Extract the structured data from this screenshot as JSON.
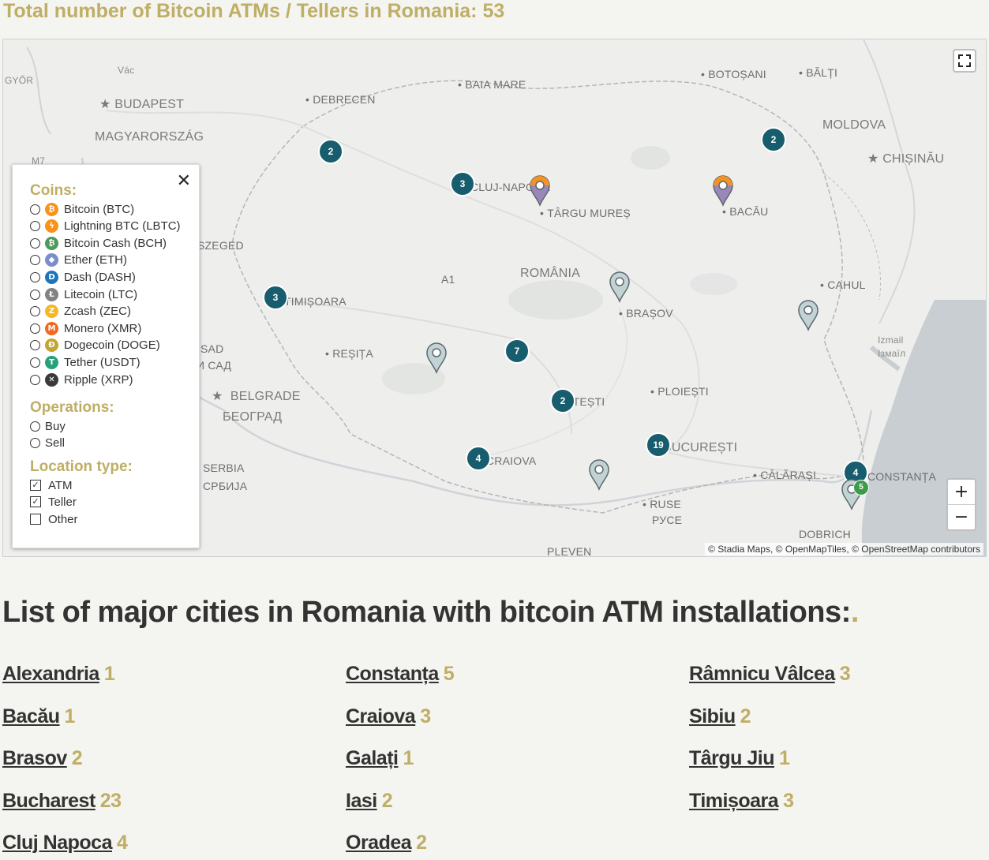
{
  "header": {
    "title": "Total number of Bitcoin ATMs / Tellers in Romania: 53"
  },
  "map": {
    "labels": [
      {
        "text": "GYŐR",
        "cls": "small"
      },
      {
        "text": "Vác",
        "cls": "small"
      },
      {
        "text": "BUDAPEST",
        "cls": "big"
      },
      {
        "text": "MAGYARORSZÁG",
        "cls": "big"
      },
      {
        "text": "DEBRECEN",
        "cls": ""
      },
      {
        "text": "BAIA MARE",
        "cls": ""
      },
      {
        "text": "BOTOȘANI",
        "cls": ""
      },
      {
        "text": "BĂLȚI",
        "cls": ""
      },
      {
        "text": "MOLDOVA",
        "cls": "big"
      },
      {
        "text": "CHIȘINĂU",
        "cls": "big"
      },
      {
        "text": "M7",
        "cls": "small"
      },
      {
        "text": "CLUJ-NAPOCA",
        "cls": ""
      },
      {
        "text": "TÂRGU MUREȘ",
        "cls": ""
      },
      {
        "text": "BACĂU",
        "cls": ""
      },
      {
        "text": "SZEGED",
        "cls": ""
      },
      {
        "text": "A1",
        "cls": ""
      },
      {
        "text": "ROMÂNIA",
        "cls": "big"
      },
      {
        "text": "CAHUL",
        "cls": ""
      },
      {
        "text": "TIMIȘOARA",
        "cls": ""
      },
      {
        "text": "BRAȘOV",
        "cls": ""
      },
      {
        "text": "REȘIȚA",
        "cls": ""
      },
      {
        "text": "Izmail",
        "cls": "small"
      },
      {
        "text": "Ізмаїл",
        "cls": "small"
      },
      {
        "text": "SAD",
        "cls": ""
      },
      {
        "text": "И САД",
        "cls": ""
      },
      {
        "text": "BELGRADE",
        "cls": "big"
      },
      {
        "text": "БЕОГРАД",
        "cls": "big"
      },
      {
        "text": "PITEȘTI",
        "cls": ""
      },
      {
        "text": "PLOIEȘTI",
        "cls": ""
      },
      {
        "text": "BUCUREȘTI",
        "cls": "big"
      },
      {
        "text": "CRAIOVA",
        "cls": ""
      },
      {
        "text": "SERBIA",
        "cls": ""
      },
      {
        "text": "СРБИЈА",
        "cls": ""
      },
      {
        "text": "CĂLĂRAȘI",
        "cls": ""
      },
      {
        "text": "CONSTANȚA",
        "cls": ""
      },
      {
        "text": "RUSE",
        "cls": ""
      },
      {
        "text": "РУСЕ",
        "cls": ""
      },
      {
        "text": "DOBRICH",
        "cls": ""
      },
      {
        "text": "PLEVEN",
        "cls": ""
      }
    ],
    "clusters": [
      "2",
      "3",
      "2",
      "3",
      "7",
      "2",
      "4",
      "19",
      "4"
    ],
    "pins": [
      {
        "color": "#9b86b8",
        "accent": "#f39227"
      },
      {
        "color": "#9b86b8",
        "accent": "#f39227"
      },
      {
        "color": "#c3d3d5",
        "accent": ""
      },
      {
        "color": "#c3d3d5",
        "accent": ""
      },
      {
        "color": "#c3d3d5",
        "accent": ""
      },
      {
        "color": "#c3d3d5",
        "accent": ""
      },
      {
        "color": "#c3d3d5",
        "accent": ""
      }
    ],
    "small_badge": "5",
    "zoom_in": "+",
    "zoom_out": "−",
    "attribution": "© Stadia Maps, © OpenMapTiles, © OpenStreetMap contributors"
  },
  "filter": {
    "close": "✕",
    "coins_title": "Coins:",
    "coins": [
      {
        "label": "Bitcoin (BTC)",
        "color": "#f7931a",
        "glyph": "₿",
        "icon": "bitcoin-icon"
      },
      {
        "label": "Lightning BTC (LBTC)",
        "color": "#f7931a",
        "glyph": "ϟ",
        "icon": "lightning-icon"
      },
      {
        "label": "Bitcoin Cash (BCH)",
        "color": "#4e9a5a",
        "glyph": "₿",
        "icon": "bitcoin-cash-icon"
      },
      {
        "label": "Ether (ETH)",
        "color": "#7b8ec9",
        "glyph": "◆",
        "icon": "ether-icon"
      },
      {
        "label": "Dash (DASH)",
        "color": "#1c75bc",
        "glyph": "D",
        "icon": "dash-icon"
      },
      {
        "label": "Litecoin (LTC)",
        "color": "#838383",
        "glyph": "Ł",
        "icon": "litecoin-icon"
      },
      {
        "label": "Zcash (ZEC)",
        "color": "#f4b728",
        "glyph": "Z",
        "icon": "zcash-icon"
      },
      {
        "label": "Monero (XMR)",
        "color": "#f26822",
        "glyph": "M",
        "icon": "monero-icon"
      },
      {
        "label": "Dogecoin (DOGE)",
        "color": "#c2a633",
        "glyph": "Ð",
        "icon": "dogecoin-icon"
      },
      {
        "label": "Tether (USDT)",
        "color": "#26a17b",
        "glyph": "T",
        "icon": "tether-icon"
      },
      {
        "label": "Ripple (XRP)",
        "color": "#3a3a3a",
        "glyph": "✕",
        "icon": "ripple-icon"
      }
    ],
    "operations_title": "Operations:",
    "operations": [
      "Buy",
      "Sell"
    ],
    "location_title": "Location type:",
    "locations": [
      {
        "label": "ATM",
        "checked": true
      },
      {
        "label": "Teller",
        "checked": true
      },
      {
        "label": "Other",
        "checked": false
      }
    ]
  },
  "list": {
    "title": "List of major cities in Romania with bitcoin ATM installations:",
    "dot": ".",
    "cities": [
      {
        "name": "Alexandria",
        "count": "1"
      },
      {
        "name": "Bacău",
        "count": "1"
      },
      {
        "name": "Brasov",
        "count": "2"
      },
      {
        "name": "Bucharest",
        "count": "23"
      },
      {
        "name": "Cluj Napoca",
        "count": "4"
      },
      {
        "name": "Constanța",
        "count": "5"
      },
      {
        "name": "Craiova",
        "count": "3"
      },
      {
        "name": "Galați",
        "count": "1"
      },
      {
        "name": "Iasi",
        "count": "2"
      },
      {
        "name": "Oradea",
        "count": "2"
      },
      {
        "name": "Râmnicu Vâlcea",
        "count": "3"
      },
      {
        "name": "Sibiu",
        "count": "2"
      },
      {
        "name": "Târgu Jiu",
        "count": "1"
      },
      {
        "name": "Timișoara",
        "count": "3"
      }
    ]
  }
}
